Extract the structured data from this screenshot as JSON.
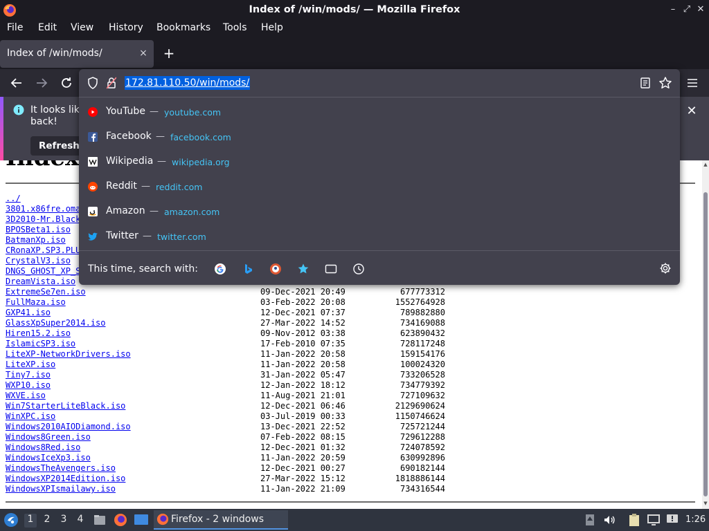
{
  "window": {
    "title": "Index of /win/mods/ — Mozilla Firefox",
    "minimize_glyph": "–",
    "maximize_glyph": "⤢",
    "close_glyph": "✕"
  },
  "menubar": {
    "items": [
      "File",
      "Edit",
      "View",
      "History",
      "Bookmarks",
      "Tools",
      "Help"
    ]
  },
  "tab": {
    "title": "Index of /win/mods/",
    "close_glyph": "×",
    "new_tab_glyph": "+"
  },
  "urlbar": {
    "value": "172.81.110.50/win/mods/"
  },
  "suggestions": [
    {
      "title": "YouTube",
      "url": "youtube.com",
      "icon": "youtube-icon",
      "color": "#ff0000"
    },
    {
      "title": "Facebook",
      "url": "facebook.com",
      "icon": "facebook-icon",
      "color": "#3b5998"
    },
    {
      "title": "Wikipedia",
      "url": "wikipedia.org",
      "icon": "wikipedia-icon",
      "color": "#ffffff"
    },
    {
      "title": "Reddit",
      "url": "reddit.com",
      "icon": "reddit-icon",
      "color": "#ff4500"
    },
    {
      "title": "Amazon",
      "url": "amazon.com",
      "icon": "amazon-icon",
      "color": "#ffffff"
    },
    {
      "title": "Twitter",
      "url": "twitter.com",
      "icon": "twitter-icon",
      "color": "#1da1f2"
    }
  ],
  "suggestion_separator": "—",
  "search": {
    "label": "This time, search with:",
    "engines": [
      "google-icon",
      "bing-icon",
      "duckduckgo-icon",
      "bookmarks-star-icon",
      "tabs-icon",
      "history-icon"
    ]
  },
  "notification": {
    "line1": "It looks like",
    "line2": "back!",
    "refresh_label": "Refresh"
  },
  "listing": {
    "heading_fragment": "Index",
    "top_partial_names": [
      "../",
      "3801.x86fre.oma",
      "3D2010-Mr.Black",
      "BPOSBeta1.iso",
      "BatmanXp.iso",
      "CRonaXP.SP3.PLU",
      "CrystalV3.iso",
      "DNGS_GHOST_XP_S",
      "DreamVista.iso"
    ],
    "rows": [
      {
        "name": "ExtremeSe7en.iso",
        "date": "09-Dec-2021 20:49",
        "size": "677773312"
      },
      {
        "name": "FullMaza.iso",
        "date": "03-Feb-2022 20:08",
        "size": "1552764928"
      },
      {
        "name": "GXP41.iso",
        "date": "12-Dec-2021 07:37",
        "size": "789882880"
      },
      {
        "name": "GlassXpSuper2014.iso",
        "date": "27-Mar-2022 14:52",
        "size": "734169088"
      },
      {
        "name": "Hiren15.2.iso",
        "date": "09-Nov-2012 03:38",
        "size": "623890432"
      },
      {
        "name": "IslamicSP3.iso",
        "date": "17-Feb-2010 07:35",
        "size": "728117248"
      },
      {
        "name": "LiteXP-NetworkDrivers.iso",
        "date": "11-Jan-2022 20:58",
        "size": "159154176"
      },
      {
        "name": "LiteXP.iso",
        "date": "11-Jan-2022 20:58",
        "size": "100024320"
      },
      {
        "name": "Tiny7.iso",
        "date": "31-Jan-2022 05:47",
        "size": "733206528"
      },
      {
        "name": "WXP10.iso",
        "date": "12-Jan-2022 18:12",
        "size": "734779392"
      },
      {
        "name": "WXVE.iso",
        "date": "11-Aug-2021 21:01",
        "size": "727109632"
      },
      {
        "name": "Win7StarterLiteBlack.iso",
        "date": "12-Dec-2021 06:46",
        "size": "2129690624"
      },
      {
        "name": "WinXPC.iso",
        "date": "03-Jul-2019 00:33",
        "size": "1150746624"
      },
      {
        "name": "Windows2010AIODiamond.iso",
        "date": "13-Dec-2021 22:52",
        "size": "725721244"
      },
      {
        "name": "Windows8Green.iso",
        "date": "07-Feb-2022 08:15",
        "size": "729612288"
      },
      {
        "name": "Windows8Red.iso",
        "date": "12-Dec-2021 01:32",
        "size": "724078592"
      },
      {
        "name": "WindowsIceXp3.iso",
        "date": "11-Jan-2022 20:59",
        "size": "630992896"
      },
      {
        "name": "WindowsTheAvengers.iso",
        "date": "12-Dec-2021 00:27",
        "size": "690182144"
      },
      {
        "name": "WindowsXP2014Edition.iso",
        "date": "27-Mar-2022 15:12",
        "size": "1818886144"
      },
      {
        "name": "WindowsXPIsmailawy.iso",
        "date": "11-Jan-2022 21:09",
        "size": "734316544"
      }
    ]
  },
  "taskbar": {
    "workspaces": [
      "1",
      "2",
      "3",
      "4"
    ],
    "active_workspace": "1",
    "task_label": "Firefox - 2 windows",
    "clock": "1:26"
  },
  "colors": {
    "chrome_dark": "#1c1b22",
    "toolbar": "#2b2a33",
    "panel": "#42414d",
    "selection": "#0060df",
    "url_suggestion": "#45c4f5",
    "link": "#0000ee",
    "taskbar": "#2f343f"
  }
}
